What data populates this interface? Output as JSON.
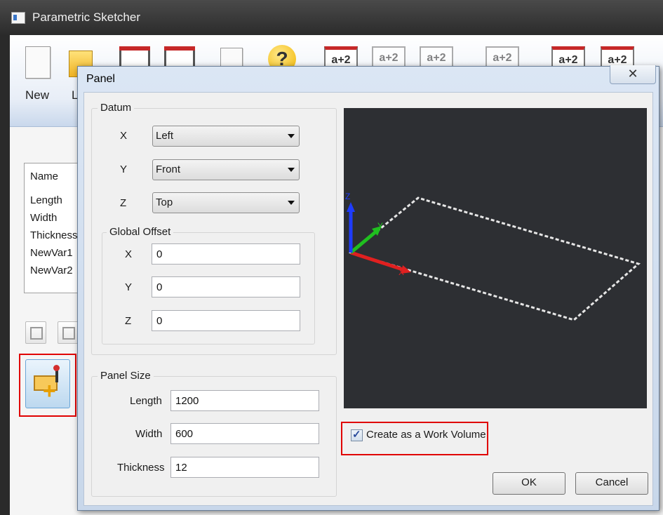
{
  "app": {
    "title": "Parametric Sketcher",
    "ribbon": {
      "new_label": "New",
      "second_label_partial": "L",
      "help_glyph": "?",
      "aplus_glyph": "a+2"
    },
    "variables": {
      "header": "Name",
      "items": [
        "Length",
        "Width",
        "Thickness",
        "NewVar1",
        "NewVar2"
      ]
    }
  },
  "dialog": {
    "title": "Panel",
    "close_glyph": "✕",
    "datum": {
      "title": "Datum",
      "x_label": "X",
      "x_value": "Left",
      "y_label": "Y",
      "y_value": "Front",
      "z_label": "Z",
      "z_value": "Top"
    },
    "global_offset": {
      "title": "Global Offset",
      "x_label": "X",
      "x_value": "0",
      "y_label": "Y",
      "y_value": "0",
      "z_label": "Z",
      "z_value": "0"
    },
    "panel_size": {
      "title": "Panel Size",
      "length_label": "Length",
      "length_value": "1200",
      "width_label": "Width",
      "width_value": "600",
      "thickness_label": "Thickness",
      "thickness_value": "12"
    },
    "viewport": {
      "axis_x": "X",
      "axis_y": "Y",
      "axis_z": "Z",
      "colors": {
        "x": "#e02020",
        "y": "#1fbf1f",
        "z": "#1e3cff",
        "outline": "#e6e6e6",
        "background": "#2d2f33"
      }
    },
    "work_volume": {
      "label": "Create as a Work Volume",
      "checked": true
    },
    "ok_label": "OK",
    "cancel_label": "Cancel"
  }
}
